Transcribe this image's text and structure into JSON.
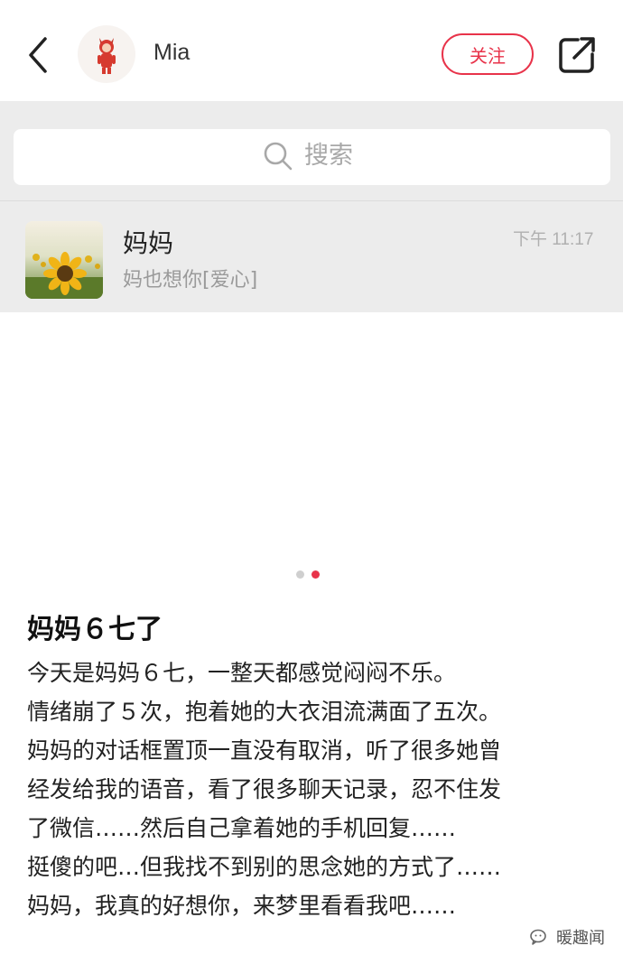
{
  "header": {
    "username": "Mia",
    "follow_label": "关注",
    "back_icon": "chevron-left-icon",
    "share_icon": "share-icon"
  },
  "search": {
    "placeholder": "搜索",
    "icon": "search-icon"
  },
  "chat": {
    "name": "妈妈",
    "preview": "妈也想你[爱心]",
    "time": "下午 11:17"
  },
  "carousel": {
    "pages": 2,
    "active_page": 2,
    "active_color": "#e8334a"
  },
  "post": {
    "title": "妈妈６七了",
    "lines": [
      "今天是妈妈６七，一整天都感觉闷闷不乐。",
      "情绪崩了５次，抱着她的大衣泪流满面了五次。",
      "妈妈的对话框置顶一直没有取消，听了很多她曾",
      "经发给我的语音，看了很多聊天记录，忍不住发",
      "了微信……然后自己拿着她的手机回复……",
      "挺傻的吧…但我找不到别的思念她的方式了……",
      "妈妈，我真的好想你，来梦里看看我吧……"
    ]
  },
  "watermark": {
    "text": "暖趣闻"
  },
  "colors": {
    "accent": "#e8334a",
    "panel_bg": "#ececec"
  }
}
